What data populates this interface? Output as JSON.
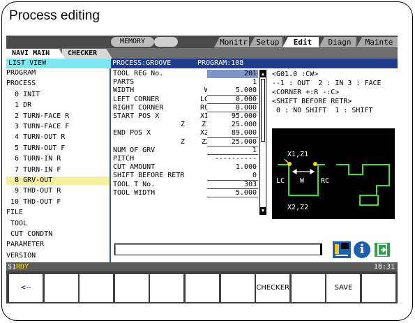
{
  "page_title": "Process editing",
  "mode_bar": {
    "mode": "MEMORY",
    "tabs": [
      {
        "label": "Monitr",
        "active": false
      },
      {
        "label": "Setup",
        "active": false
      },
      {
        "label": "Edit",
        "active": true
      },
      {
        "label": "Diagn",
        "active": false
      },
      {
        "label": "Mainte",
        "active": false
      }
    ]
  },
  "sub_tabs": {
    "navi_main": "NAVI MAIN",
    "checker": "CHECKER"
  },
  "list": {
    "header": "LIST VIEW",
    "items": [
      {
        "label": "PROGRAM",
        "selected": false
      },
      {
        "label": "PROCESS",
        "selected": false
      },
      {
        "label": "  0 INIT",
        "selected": false
      },
      {
        "label": "  1 DR",
        "selected": false
      },
      {
        "label": "  2 TURN-FACE R",
        "selected": false
      },
      {
        "label": "  3 TURN-FACE F",
        "selected": false
      },
      {
        "label": "  4 TURN-OUT R",
        "selected": false
      },
      {
        "label": "  5 TURN-OUT F",
        "selected": false
      },
      {
        "label": "  6 TURN-IN R",
        "selected": false
      },
      {
        "label": "  7 TURN-IN F",
        "selected": false
      },
      {
        "label": "  8 GRV-OUT",
        "selected": true
      },
      {
        "label": "  9 THD-OUT R",
        "selected": false
      },
      {
        "label": " 10 THD-OUT F",
        "selected": false
      },
      {
        "label": "FILE",
        "selected": false
      },
      {
        "label": " TOOL",
        "selected": false
      },
      {
        "label": " CUT CONDTN",
        "selected": false
      },
      {
        "label": "PARAMETER",
        "selected": false
      },
      {
        "label": "VERSION",
        "selected": false
      }
    ]
  },
  "process_header": {
    "process": "PROCESS:GROOVE",
    "program": "PROGRAM:108"
  },
  "params": [
    {
      "name": "TOOL REG No.",
      "sym": "",
      "value": "201",
      "highlight": true
    },
    {
      "name": "PARTS",
      "sym": "",
      "value": "1",
      "highlight": false
    },
    {
      "name": "WIDTH",
      "sym": "W",
      "value": "5.000",
      "highlight": false
    },
    {
      "name": "LEFT CORNER",
      "sym": "LC",
      "value": "0.000",
      "highlight": false
    },
    {
      "name": "RIGHT CORNER",
      "sym": "RC",
      "value": "0.000",
      "highlight": false
    },
    {
      "name": "START POS X",
      "sym": "X1",
      "value": "95.000",
      "highlight": false
    },
    {
      "name": "",
      "sym": "Z    Z1",
      "value": "25.000",
      "highlight": false
    },
    {
      "name": "END POS X",
      "sym": "X2",
      "value": "89.000",
      "highlight": false
    },
    {
      "name": "",
      "sym": "Z    Z2",
      "value": "25.000",
      "highlight": false
    },
    {
      "name": "NUM OF GRV",
      "sym": "",
      "value": "1",
      "highlight": false
    },
    {
      "name": "PITCH",
      "sym": "",
      "value": "----------",
      "highlight": false
    },
    {
      "name": "CUT AMOUNT",
      "sym": "",
      "value": "1.000",
      "highlight": false
    },
    {
      "name": "SHIFT BEFORE RETR",
      "sym": "",
      "value": "0",
      "highlight": false
    },
    {
      "name": "TOOL T No.",
      "sym": "",
      "value": "303",
      "highlight": false
    },
    {
      "name": "TOOL WIDTH",
      "sym": "",
      "value": "5.000",
      "highlight": false
    }
  ],
  "help_lines": [
    "<G01.0 :CW>",
    "--1 : OUT  2 : IN 3 : FACE",
    "<CORNER +:R -:C>",
    "<SHIFT BEFORE RETR>",
    " 0 : NO SHIFT  1 : SHIFT"
  ],
  "diagram_labels": {
    "start": "X1,Z1",
    "end": "X2,Z2",
    "left": "LC",
    "width": "W",
    "right": "RC"
  },
  "status_bar": {
    "prefix": "$1",
    "state": "RDY",
    "time": "18:31"
  },
  "softkeys": [
    "<--",
    "",
    "",
    "",
    "",
    "",
    "",
    "CHECKER",
    "",
    "SAVE",
    ""
  ],
  "colors": {
    "list_header": "#7ee8f0",
    "selected_row": "#f4f09e",
    "header_blue": "#1f3d8a",
    "status_yellow": "#ffd800",
    "diagram_green": "#3fe03a"
  }
}
